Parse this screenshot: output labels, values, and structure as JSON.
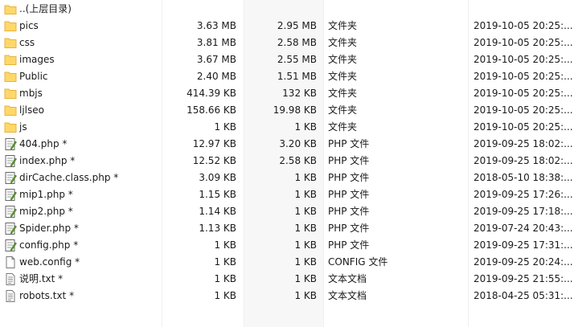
{
  "rows": [
    {
      "icon": "folder-up-icon",
      "name": "..(上层目录)",
      "size": "",
      "packed": "",
      "type": "",
      "modified": ""
    },
    {
      "icon": "folder-icon",
      "name": "pics",
      "size": "3.63 MB",
      "packed": "2.95 MB",
      "type": "文件夹",
      "modified": "2019-10-05 20:25:..."
    },
    {
      "icon": "folder-icon",
      "name": "css",
      "size": "3.81 MB",
      "packed": "2.58 MB",
      "type": "文件夹",
      "modified": "2019-10-05 20:25:..."
    },
    {
      "icon": "folder-icon",
      "name": "images",
      "size": "3.67 MB",
      "packed": "2.55 MB",
      "type": "文件夹",
      "modified": "2019-10-05 20:25:..."
    },
    {
      "icon": "folder-icon",
      "name": "Public",
      "size": "2.40 MB",
      "packed": "1.51 MB",
      "type": "文件夹",
      "modified": "2019-10-05 20:25:..."
    },
    {
      "icon": "folder-icon",
      "name": "mbjs",
      "size": "414.39 KB",
      "packed": "132 KB",
      "type": "文件夹",
      "modified": "2019-10-05 20:25:..."
    },
    {
      "icon": "folder-icon",
      "name": "ljlseo",
      "size": "158.66 KB",
      "packed": "19.98 KB",
      "type": "文件夹",
      "modified": "2019-10-05 20:25:..."
    },
    {
      "icon": "folder-icon",
      "name": "js",
      "size": "1 KB",
      "packed": "1 KB",
      "type": "文件夹",
      "modified": "2019-10-05 20:25:..."
    },
    {
      "icon": "php-file-icon",
      "name": "404.php *",
      "size": "12.97 KB",
      "packed": "3.20 KB",
      "type": "PHP 文件",
      "modified": "2019-09-25 18:02:..."
    },
    {
      "icon": "php-file-icon",
      "name": "index.php *",
      "size": "12.52 KB",
      "packed": "2.58 KB",
      "type": "PHP 文件",
      "modified": "2019-09-25 18:02:..."
    },
    {
      "icon": "php-file-icon",
      "name": "dirCache.class.php *",
      "size": "3.09 KB",
      "packed": "1 KB",
      "type": "PHP 文件",
      "modified": "2018-05-10 18:38:..."
    },
    {
      "icon": "php-file-icon",
      "name": "mip1.php *",
      "size": "1.15 KB",
      "packed": "1 KB",
      "type": "PHP 文件",
      "modified": "2019-09-25 17:26:..."
    },
    {
      "icon": "php-file-icon",
      "name": "mip2.php *",
      "size": "1.14 KB",
      "packed": "1 KB",
      "type": "PHP 文件",
      "modified": "2019-09-25 17:18:..."
    },
    {
      "icon": "php-file-icon",
      "name": "Spider.php *",
      "size": "1.13 KB",
      "packed": "1 KB",
      "type": "PHP 文件",
      "modified": "2019-07-24 20:43:..."
    },
    {
      "icon": "php-file-icon",
      "name": "config.php *",
      "size": "1 KB",
      "packed": "1 KB",
      "type": "PHP 文件",
      "modified": "2019-09-25 17:31:..."
    },
    {
      "icon": "config-file-icon",
      "name": "web.config *",
      "size": "1 KB",
      "packed": "1 KB",
      "type": "CONFIG 文件",
      "modified": "2019-09-25 20:24:..."
    },
    {
      "icon": "text-file-icon",
      "name": "说明.txt *",
      "size": "1 KB",
      "packed": "1 KB",
      "type": "文本文档",
      "modified": "2019-09-25 21:55:..."
    },
    {
      "icon": "text-file-icon",
      "name": "robots.txt *",
      "size": "1 KB",
      "packed": "1 KB",
      "type": "文本文档",
      "modified": "2018-04-25 05:31:..."
    }
  ],
  "colors": {
    "folder": "#ffd869",
    "folder_dark": "#e8b23c",
    "php_green": "#5aa02c",
    "size_band": "#f7f7f7"
  }
}
